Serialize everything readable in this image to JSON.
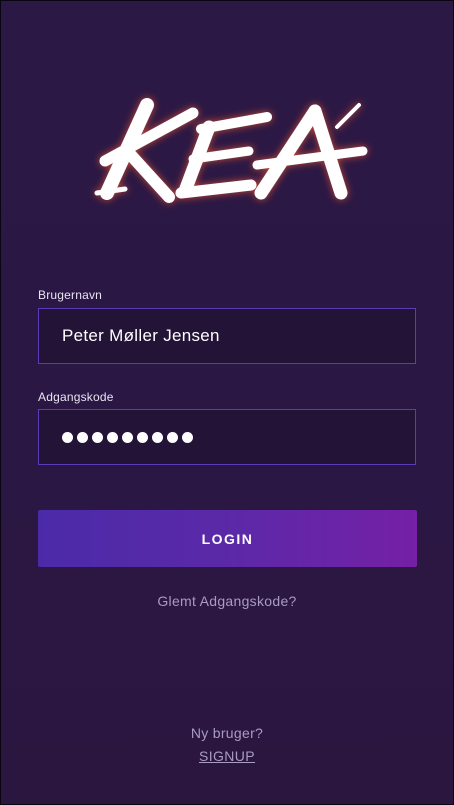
{
  "logo": {
    "text": "KEA",
    "color": "#ffffff",
    "glow_color": "#ff6a3d"
  },
  "username": {
    "label": "Brugernavn",
    "value": "Peter Møller Jensen"
  },
  "password": {
    "label": "Adgangskode",
    "masked_length": 9
  },
  "login_button": {
    "label": "LOGIN"
  },
  "forgot_password": {
    "label": "Glemt Adgangskode?"
  },
  "signup": {
    "prompt": "Ny bruger?",
    "label": "SIGNUP"
  },
  "colors": {
    "background": "#2b1742",
    "field_border": "#5b3bb8",
    "button_gradient_start": "#4b2aa8",
    "button_gradient_end": "#7520a6",
    "muted_text": "#a99bc4"
  }
}
